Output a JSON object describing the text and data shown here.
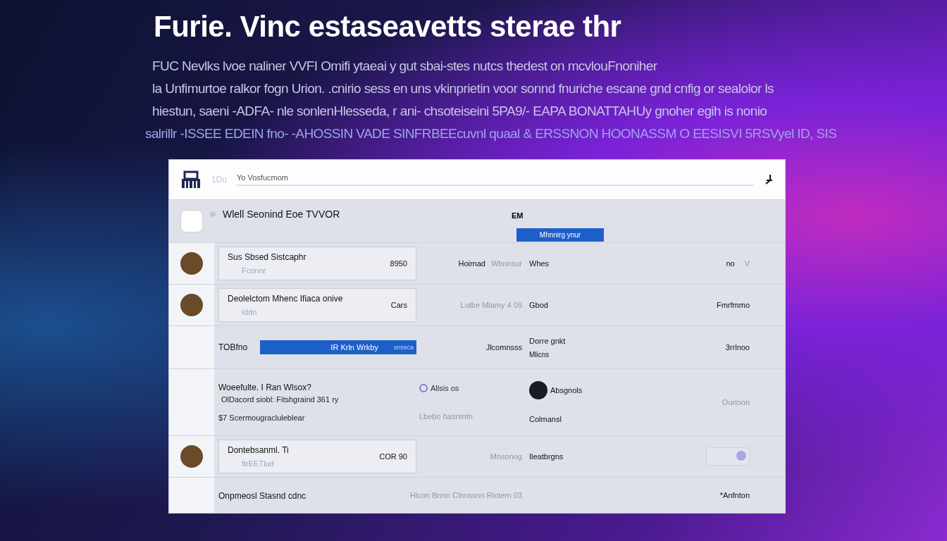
{
  "hero": {
    "title": "Furie. Vinc estaseavetts sterae thr",
    "lines": [
      "FUC Nevlks lvoe naliner VVFI Omifi ytaeai y gut sbai-stes nutcs thedest on mcvlouFnoniher",
      "la Unfimurtoe ralkor fogn Urion. .cnirio sess en uns vkinprietin voor sonnd fnuriche escane gnd cnfig or sealolor ls",
      "hiestun, saeni -ADFA- nle sonlenHlesseda, r ani- chsoteiseini 5PA9/- EAPA BONATTAHUy gnoher egih is nonio",
      "salrillr -ISSEE EDEIN fno- -AHOSSIN VADE SINFRBEEcuvnl quaal & ERSSNON HOONASSM O EESISVI 5RSVyel ID, SIS"
    ]
  },
  "toolbar": {
    "faint": "1Du",
    "label": "Yo Vosfucmom"
  },
  "section": {
    "title": "Wlell Seonind Eoe TVVOR",
    "tag": "EM",
    "button": "Mhnnirg ynur"
  },
  "rows": [
    {
      "kind": "contact",
      "title": "Sus Sbsed Sistcaphr",
      "subtitle": "Fconnr",
      "amount": "8950",
      "c2": "Hoirnad",
      "c2b": "Wbnnsur",
      "c3": "Whes",
      "c4": "no",
      "c4b": "V"
    },
    {
      "kind": "contact",
      "title": "Deolelctom Mhenc Ifiaca onive",
      "subtitle": "Iddn",
      "amount": "Cars",
      "c2b": "Lutbe Mlamy 4 09",
      "c3": "Gbod",
      "c4": "Fmrfmmo"
    },
    {
      "kind": "bar",
      "title": "TOBfno",
      "bar": "IR Krln Wrkby",
      "bartail": "snssca",
      "c2": "Jlcomnsss",
      "c3": "Dorre gnkt",
      "c3b": "Mlicns",
      "c4": "3rrlnoo"
    },
    {
      "kind": "detail",
      "title": "Woeefulte. I Ran Wlsox?",
      "subtitle": "OlDacord siobl: Fitshgraind 361 ry",
      "note": "$7 Scermougracluleblear",
      "chip": "Allsis os",
      "person": "Absgnols",
      "c2b": "Lbebo hasntotn",
      "c3": "Colmansl",
      "c4b": "Ourloon"
    },
    {
      "kind": "contact",
      "title": "Dontebsanml. Ti",
      "subtitle": "ItrEETlud",
      "amount": "COR 90",
      "c2b": "Mnsonog",
      "c3": "Ileatbrgns",
      "toggle": {
        "on": true
      }
    },
    {
      "kind": "plain",
      "title": "Onpmeosl Stasnd cdnc",
      "c2b": "Hlcon Bnnn Clnnssnn Rlotem 03",
      "c4": "*Anfnton"
    }
  ]
}
